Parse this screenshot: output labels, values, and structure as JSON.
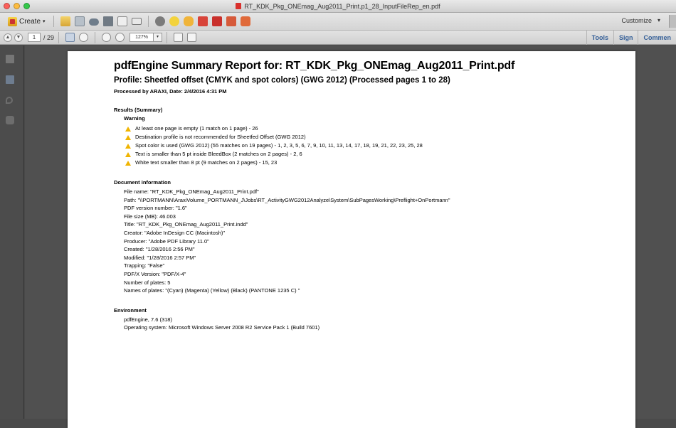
{
  "window": {
    "title": "RT_KDK_Pkg_ONEmag_Aug2011_Print.p1_28_InputFileRep_en.pdf"
  },
  "toolbar": {
    "create_label": "Create",
    "customize_label": "Customize"
  },
  "nav": {
    "current_page": "1",
    "total_pages": "/ 29",
    "zoom": "127%",
    "right_links": [
      "Tools",
      "Sign",
      "Commen"
    ]
  },
  "report": {
    "title": "pdfEngine Summary Report for: RT_KDK_Pkg_ONEmag_Aug2011_Print.pdf",
    "profile": "Profile: Sheetfed offset (CMYK and spot colors) (GWG 2012) (Processed pages 1 to 28)",
    "processed_by": "Processed by ARAXI, Date: 2/4/2016 4:31 PM",
    "results_heading": "Results (Summary)",
    "warning_heading": "Warning",
    "warnings": [
      "At least one page is empty (1 match on 1 page) - 26",
      "Destination profile is not recommended for Sheetfed Offset (GWG 2012)",
      "Spot color is used (GWG 2012) (55 matches on 19 pages) - 1, 2, 3, 5, 6, 7, 9, 10, 11, 13, 14, 17, 18, 19, 21, 22, 23, 25, 28",
      "Text is smaller than 5 pt inside BleedBox (2 matches on 2 pages) - 2, 6",
      "White text smaller than 8 pt (9 matches on 2 pages) - 15, 23"
    ],
    "docinfo_heading": "Document information",
    "docinfo": [
      "File name: \"RT_KDK_Pkg_ONEmag_Aug2011_Print.pdf\"",
      "Path: \"\\\\PORTMANN\\AraxiVolume_PORTMANN_J\\Jobs\\RT_ActivityGWG2012Analyze\\System\\SubPagesWorking\\Preflight+OnPortmann\"",
      "PDF version number: \"1.6\"",
      "File size (MB): 46.003",
      "Title: \"RT_KDK_Pkg_ONEmag_Aug2011_Print.indd\"",
      "Creator: \"Adobe InDesign CC (Macintosh)\"",
      "Producer: \"Adobe PDF Library 11.0\"",
      "Created: \"1/28/2016 2:56 PM\"",
      "Modified: \"1/28/2016 2:57 PM\"",
      "Trapping: \"False\"",
      "PDF/X Version: \"PDF/X-4\"",
      "Number of plates: 5",
      "Names of plates: \"(Cyan) (Magenta) (Yellow) (Black) (PANTONE 1235 C) \""
    ],
    "env_heading": "Environment",
    "env": [
      "pdfEngine, 7.6 (318)",
      "Operating system: Microsoft Windows Server 2008 R2 Service Pack 1 (Build 7601)"
    ]
  }
}
